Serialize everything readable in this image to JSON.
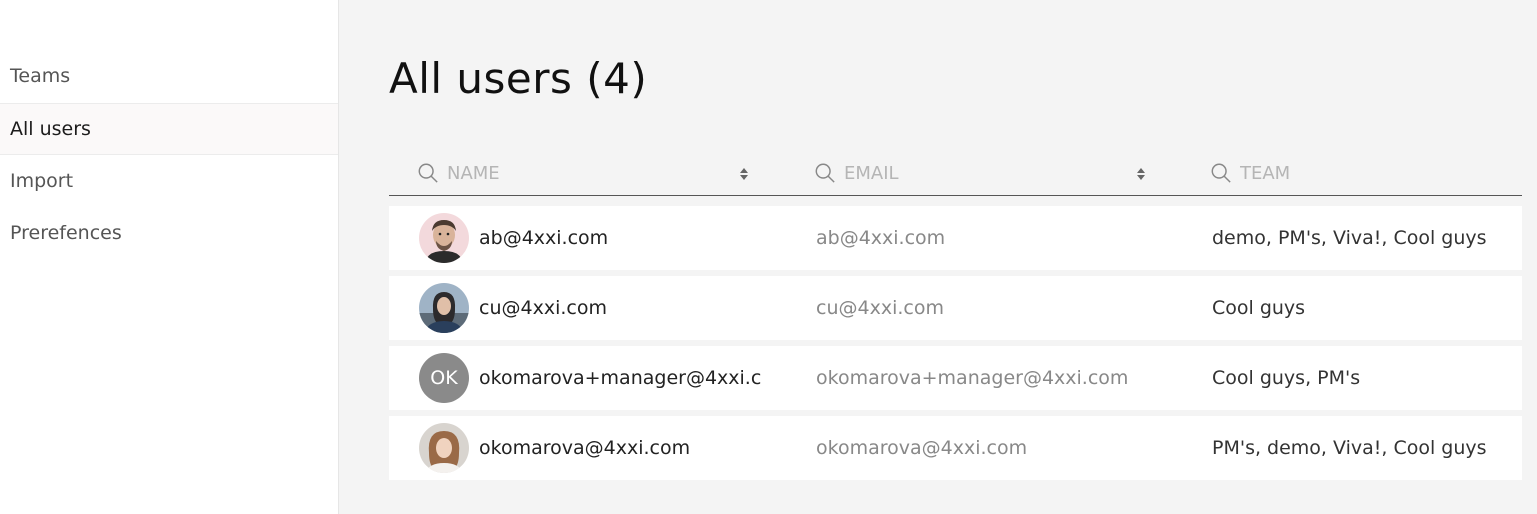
{
  "sidebar": {
    "items": [
      {
        "label": "Teams",
        "active": false
      },
      {
        "label": "All users",
        "active": true
      },
      {
        "label": "Import",
        "active": false
      },
      {
        "label": "Prerefences",
        "active": false
      }
    ]
  },
  "main": {
    "title": "All users (4)",
    "columns": [
      {
        "placeholder": "NAME",
        "sortable": true,
        "icon": "search-icon"
      },
      {
        "placeholder": "EMAIL",
        "sortable": true,
        "icon": "search-icon"
      },
      {
        "placeholder": "TEAM",
        "sortable": false,
        "icon": "search-icon"
      }
    ],
    "users": [
      {
        "name": "ab@4xxi.com",
        "email": "ab@4xxi.com",
        "teams": "demo, PM's, Viva!, Cool guys",
        "avatar": "photo-man"
      },
      {
        "name": "cu@4xxi.com",
        "email": "cu@4xxi.com",
        "teams": "Cool guys",
        "avatar": "photo-woman-dark"
      },
      {
        "name": "okomarova+manager@4xxi.c",
        "email": "okomarova+manager@4xxi.com",
        "teams": "Cool guys, PM's",
        "avatar_initials": "OK"
      },
      {
        "name": "okomarova@4xxi.com",
        "email": "okomarova@4xxi.com",
        "teams": "PM's, demo, Viva!, Cool guys",
        "avatar": "photo-woman-light"
      }
    ]
  },
  "colors": {
    "sidebar_bg": "#ffffff",
    "main_bg": "#f4f4f4",
    "row_bg": "#ffffff",
    "initials_avatar_bg": "#8a8a8a",
    "email_text": "#888888"
  }
}
